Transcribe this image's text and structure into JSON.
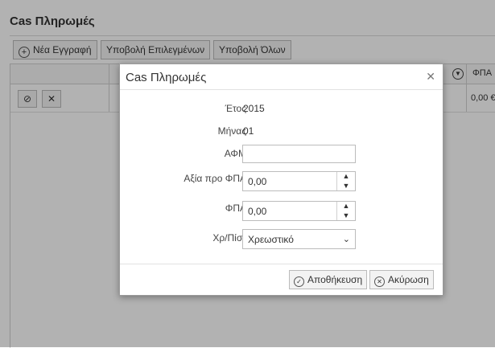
{
  "page": {
    "title": "Cas Πληρωμές"
  },
  "toolbar": {
    "new_label": "Νέα Εγγραφή",
    "submit_selected_label": "Υποβολή Επιλεγμένων",
    "submit_all_label": "Υποβολή Όλων"
  },
  "grid": {
    "header_fpa": "ΦΠΑ",
    "row_fpa_value": "0,00 €"
  },
  "modal": {
    "title": "Cas Πληρωμές",
    "fields": {
      "year_label": "Έτος",
      "year_value": "2015",
      "month_label": "Μήνας",
      "month_value": "01",
      "afm_label": "ΑΦΜ",
      "afm_value": "",
      "value_label": "Αξία προ ΦΠΑ",
      "value_value": "0,00",
      "fpa_label": "ΦΠΑ",
      "fpa_value": "0,00",
      "type_label": "Χρ/Πίστ",
      "type_value": "Χρεωστικό"
    },
    "save_label": "Αποθήκευση",
    "cancel_label": "Ακύρωση"
  }
}
